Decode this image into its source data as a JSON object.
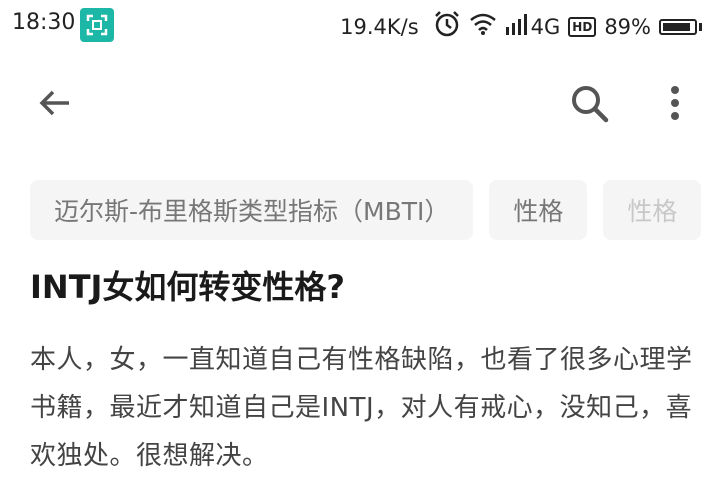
{
  "status_bar": {
    "time": "18:30",
    "net_speed": "19.4K/s",
    "network": "4G",
    "hd_label": "HD",
    "battery": "89%",
    "battery_level": 0.89,
    "icons": [
      "scan-icon",
      "alarm-icon",
      "wifi-icon",
      "signal-icon",
      "battery-icon"
    ]
  },
  "app_bar": {
    "icons": [
      "back-arrow-icon",
      "search-icon",
      "more-vertical-icon"
    ]
  },
  "topics": [
    {
      "label": "迈尔斯-布里格斯类型指标（MBTI）"
    },
    {
      "label": "性格"
    },
    {
      "label": "性格"
    }
  ],
  "question": {
    "title": "INTJ女如何转变性格?",
    "body": "本人，女，一直知道自己有性格缺陷，也看了很多心理学书籍，最近才知道自己是INTJ，对人有戒心，没知己，喜欢独处。很想解决。"
  },
  "colors": {
    "scan_badge": "#1cb7a6",
    "chip_bg": "#f5f5f5",
    "chip_text": "#777777",
    "title_text": "#1a1a1a",
    "body_text": "#444444"
  }
}
